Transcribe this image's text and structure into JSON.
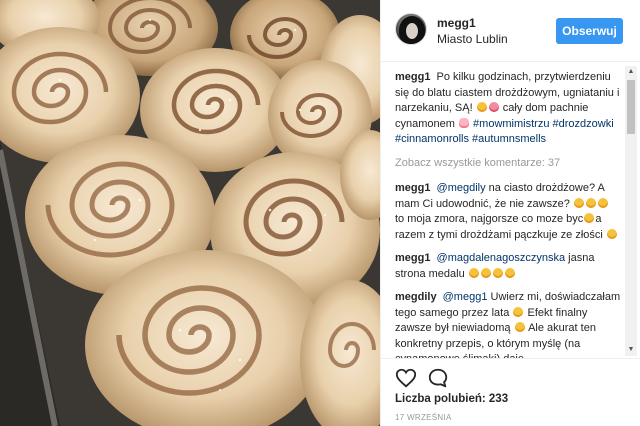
{
  "post": {
    "author": "megg1",
    "location": "Miasto Lublin",
    "follow_label": "Obserwuj",
    "caption": {
      "user": "megg1",
      "text": "Po kilku godzinach, przytwierdzeniu się do blatu ciastem drożdżowym, ugniataniu i narzekaniu, SĄ!",
      "text2": "cały dom pachnie cynamonem",
      "tags": [
        "#mowmimistrzu",
        "#drozdzowki",
        "#cinnamonrolls",
        "#autumnsmells"
      ]
    },
    "view_all_comments": "Zobacz wszystkie komentarze: 37",
    "comments": [
      {
        "user": "megg1",
        "mention": "@megdily",
        "text": "na ciasto drożdżowe? A mam Ci udowodnić, że nie zawsze?",
        "text2": "to moja zmora, najgorsze co moze byc",
        "text3": "a razem z tymi drożdżami pączkuje ze złości"
      },
      {
        "user": "megg1",
        "mention": "@magdalenagoszczynska",
        "text": "jasna strona medalu"
      },
      {
        "user": "megdily",
        "mention": "@megg1",
        "text": "Uwierz mi, doświadczałam tego samego przez lata",
        "text2": "Efekt finalny zawsze był niewiadomą",
        "text3": "Ale akurat ten konkretny przepis, o którym myślę (na cynamonowe ślimaki) daje"
      }
    ],
    "likes": "Liczba polubień: 233",
    "date": "17 WRZEŚNIA"
  },
  "icons": {
    "like": "heart-outline-icon",
    "comment": "speech-bubble-icon"
  },
  "colors": {
    "follow_button": "#3897f0",
    "link": "#003569",
    "muted": "#999999"
  }
}
